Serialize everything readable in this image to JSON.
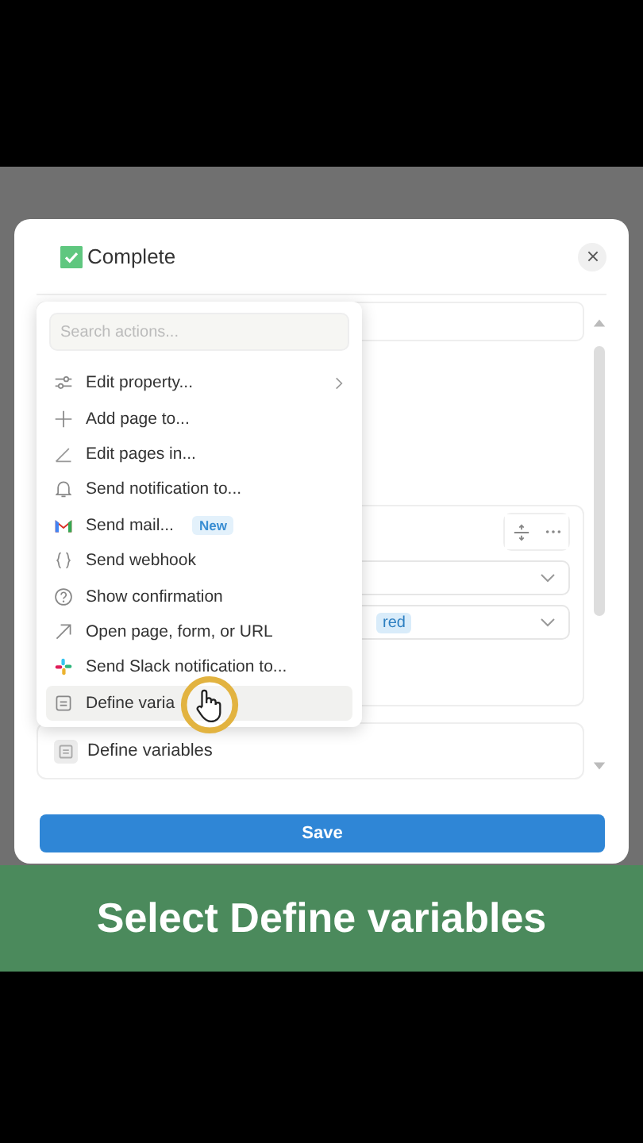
{
  "dialog": {
    "title": "Complete",
    "title_checked": true
  },
  "menu": {
    "search": {
      "placeholder": "Search actions..."
    },
    "items": [
      {
        "kind": "sliders",
        "label": "Edit property...",
        "submenu": true,
        "selected": false
      },
      {
        "kind": "plus",
        "label": "Add page to...",
        "submenu": false,
        "selected": false
      },
      {
        "kind": "pencil",
        "label": "Edit pages in...",
        "submenu": false,
        "selected": false
      },
      {
        "kind": "bell",
        "label": "Send notification to...",
        "submenu": false,
        "selected": false
      },
      {
        "kind": "mail",
        "label": "Send mail...",
        "badge": "New",
        "submenu": false,
        "selected": false
      },
      {
        "kind": "braces",
        "label": "Send webhook",
        "submenu": false,
        "selected": false
      },
      {
        "kind": "question",
        "label": "Show confirmation",
        "submenu": false,
        "selected": false
      },
      {
        "kind": "arrow",
        "label": "Open page, form, or URL",
        "submenu": false,
        "selected": false
      },
      {
        "kind": "slack",
        "label": "Send Slack notification to...",
        "submenu": false,
        "selected": false
      },
      {
        "kind": "variable",
        "label": "Define varia",
        "submenu": false,
        "selected": true
      }
    ]
  },
  "action_card": {
    "tag": "red"
  },
  "variables_card": {
    "label": "Define variables"
  },
  "save_button": "Save",
  "caption": "Select Define variables"
}
